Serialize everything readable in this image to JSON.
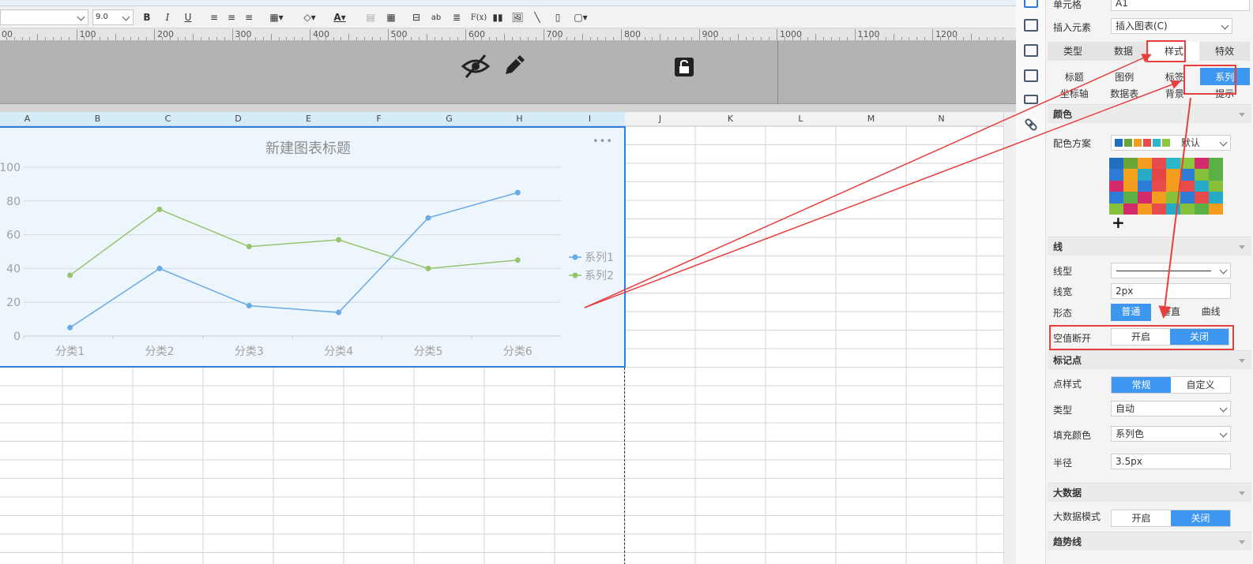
{
  "toolbar": {
    "font_size": "9.0",
    "bold": "B",
    "italic": "I",
    "underline": "U",
    "text_color_icon": "A",
    "wrap_icon": "ab",
    "formula_icon": "F(x)"
  },
  "ruler": {
    "ticks": [
      "00",
      "100",
      "200",
      "300",
      "400",
      "500",
      "600",
      "700",
      "800",
      "900",
      "1000",
      "1100",
      "1200"
    ]
  },
  "sheet": {
    "columns": [
      "A",
      "B",
      "C",
      "D",
      "E",
      "F",
      "G",
      "H",
      "I",
      "J",
      "K",
      "L",
      "M",
      "N"
    ]
  },
  "chart_data": {
    "type": "line",
    "title": "新建图表标题",
    "categories": [
      "分类1",
      "分类2",
      "分类3",
      "分类4",
      "分类5",
      "分类6"
    ],
    "series": [
      {
        "name": "系列1",
        "color": "#6aaae4",
        "values": [
          5,
          40,
          18,
          14,
          70,
          85
        ]
      },
      {
        "name": "系列2",
        "color": "#97c46c",
        "values": [
          36,
          75,
          53,
          57,
          40,
          45
        ]
      }
    ],
    "y_ticks": [
      "0",
      "20",
      "40",
      "60",
      "80",
      "100"
    ],
    "ylim": [
      0,
      100
    ],
    "grid": true,
    "legend": "right",
    "more_icon": "•••"
  },
  "panel": {
    "cell_label": "单元格",
    "cell_value": "A1",
    "insert_label": "插入元素",
    "insert_value": "插入图表(C)",
    "main_tabs": [
      "类型",
      "数据",
      "样式",
      "特效"
    ],
    "sub_tabs_row1": [
      "标题",
      "图例",
      "标签",
      "系列"
    ],
    "sub_tabs_row2": [
      "坐标轴",
      "数据表",
      "背景",
      "提示"
    ],
    "color_section": "颜色",
    "scheme_label": "配色方案",
    "scheme_value": "默认",
    "line_section": "线",
    "line_type_label": "线型",
    "line_width_label": "线宽",
    "line_width_value": "2px",
    "shape_label": "形态",
    "shape_options": [
      "普通",
      "垂直",
      "曲线"
    ],
    "null_break_label": "空值断开",
    "null_break_options": [
      "开启",
      "关闭"
    ],
    "marker_section": "标记点",
    "point_style_label": "点样式",
    "point_style_options": [
      "常规",
      "自定义"
    ],
    "type_label": "类型",
    "type_value": "自动",
    "fill_label": "填充颜色",
    "fill_value": "系列色",
    "radius_label": "半径",
    "radius_value": "3.5px",
    "bigdata_section": "大数据",
    "bigdata_mode_label": "大数据模式",
    "bigdata_options": [
      "开启",
      "关闭"
    ],
    "trend_section": "趋势线"
  },
  "palette": [
    "#1f6fbf",
    "#6aa53a",
    "#f39c1f",
    "#e84b4b",
    "#2bb7c9",
    "#8bc83d",
    "#d22a6a",
    "#5ab044",
    "#2c7bd6",
    "#f4a21e",
    "#27a9c8",
    "#e64545",
    "#f39c1f",
    "#2c7bd6",
    "#87c13c",
    "#5ab044",
    "#d22a6a",
    "#f39c1f",
    "#2c7bd6",
    "#e84b4b",
    "#f39c1f",
    "#e84b4b",
    "#27a9c8",
    "#87c13c",
    "#2c7bd6",
    "#5ab044",
    "#d22a6a",
    "#f39c1f",
    "#87c13c",
    "#2c7bd6",
    "#e84b4b",
    "#27a9c8",
    "#87c13c",
    "#d22a6a",
    "#f39c1f",
    "#e84b4b",
    "#27a9c8",
    "#87c13c",
    "#5ab044",
    "#f39c1f"
  ]
}
